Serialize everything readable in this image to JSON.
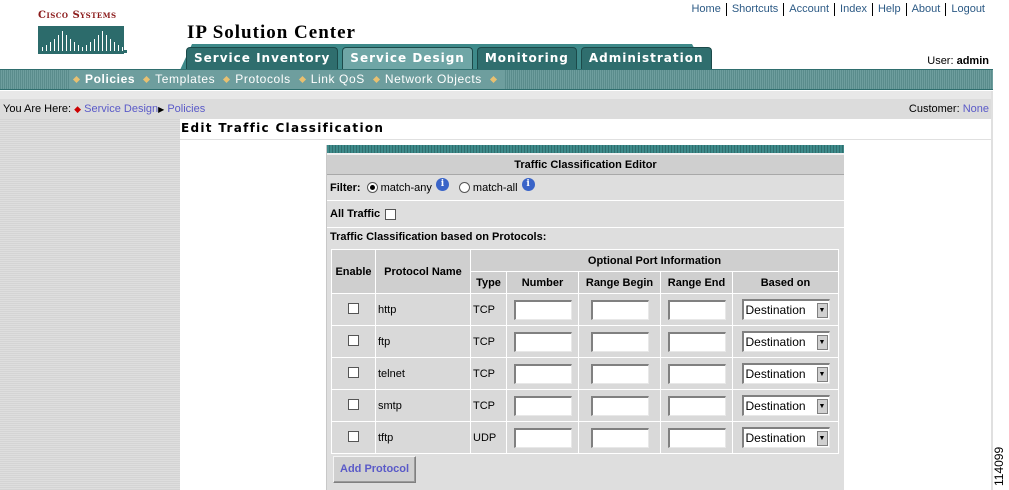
{
  "brand": {
    "logo_text": "Cisco Systems"
  },
  "app": {
    "title": "IP Solution Center"
  },
  "top_links": [
    "Home",
    "Shortcuts",
    "Account",
    "Index",
    "Help",
    "About",
    "Logout"
  ],
  "user": {
    "label": "User:",
    "name": "admin"
  },
  "tabs": [
    {
      "label": "Service Inventory",
      "active": false
    },
    {
      "label": "Service Design",
      "active": true
    },
    {
      "label": "Monitoring",
      "active": false
    },
    {
      "label": "Administration",
      "active": false
    }
  ],
  "subnav": [
    {
      "label": "Policies",
      "active": true
    },
    {
      "label": "Templates",
      "active": false
    },
    {
      "label": "Protocols",
      "active": false
    },
    {
      "label": "Link QoS",
      "active": false
    },
    {
      "label": "Network Objects",
      "active": false
    }
  ],
  "breadcrumb": {
    "prefix": "You Are Here:",
    "items": [
      "Service Design",
      "Policies"
    ]
  },
  "customer": {
    "label": "Customer:",
    "value": "None"
  },
  "page": {
    "title": "Edit Traffic Classification"
  },
  "editor": {
    "header": "Traffic Classification Editor",
    "filter_label": "Filter:",
    "filter_options": [
      {
        "label": "match-any",
        "selected": true
      },
      {
        "label": "match-all",
        "selected": false
      }
    ],
    "all_traffic_label": "All Traffic",
    "all_traffic_checked": false,
    "protocols_label": "Traffic Classification based on Protocols:",
    "columns": {
      "enable": "Enable",
      "protocol_name": "Protocol Name",
      "optional_port": "Optional Port Information",
      "type": "Type",
      "number": "Number",
      "range_begin": "Range Begin",
      "range_end": "Range End",
      "based_on": "Based on"
    },
    "rows": [
      {
        "name": "http",
        "type": "TCP",
        "number": "",
        "range_begin": "",
        "range_end": "",
        "based_on": "Destination",
        "enabled": false
      },
      {
        "name": "ftp",
        "type": "TCP",
        "number": "",
        "range_begin": "",
        "range_end": "",
        "based_on": "Destination",
        "enabled": false
      },
      {
        "name": "telnet",
        "type": "TCP",
        "number": "",
        "range_begin": "",
        "range_end": "",
        "based_on": "Destination",
        "enabled": false
      },
      {
        "name": "smtp",
        "type": "TCP",
        "number": "",
        "range_begin": "",
        "range_end": "",
        "based_on": "Destination",
        "enabled": false
      },
      {
        "name": "tftp",
        "type": "UDP",
        "number": "",
        "range_begin": "",
        "range_end": "",
        "based_on": "Destination",
        "enabled": false
      }
    ],
    "add_button": "Add Protocol"
  },
  "figure_number": "114099",
  "colors": {
    "teal": "#2f6e6e",
    "teal_light": "#6e9e9e",
    "link": "#5a5ac8",
    "logo_red": "#8b1a1a"
  }
}
